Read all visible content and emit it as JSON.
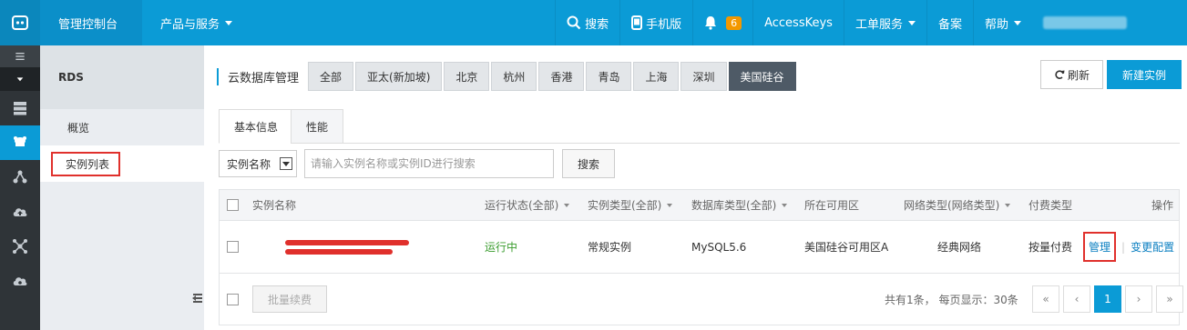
{
  "topbar": {
    "console": "管理控制台",
    "products": "产品与服务",
    "search": "搜索",
    "mobile": "手机版",
    "notify_count": "6",
    "accesskeys": "AccessKeys",
    "tickets": "工单服务",
    "beian": "备案",
    "help": "帮助"
  },
  "sidebar": {
    "title": "RDS",
    "items": [
      {
        "label": "概览"
      },
      {
        "label": "实例列表"
      }
    ]
  },
  "regions": {
    "label": "云数据库管理",
    "items": [
      "全部",
      "亚太(新加坡)",
      "北京",
      "杭州",
      "香港",
      "青岛",
      "上海",
      "深圳",
      "美国硅谷"
    ],
    "selected": "美国硅谷"
  },
  "actions": {
    "refresh": "刷新",
    "new_instance": "新建实例"
  },
  "tabs": [
    "基本信息",
    "性能"
  ],
  "search": {
    "select_value": "实例名称",
    "placeholder": "请输入实例名称或实例ID进行搜索",
    "button": "搜索"
  },
  "table": {
    "headers": {
      "name": "实例名称",
      "status": "运行状态(全部)",
      "type": "实例类型(全部)",
      "db_type": "数据库类型(全部)",
      "zone": "所在可用区",
      "network": "网络类型(网络类型)",
      "billing": "付费类型",
      "ops": "操作"
    },
    "rows": [
      {
        "status": "运行中",
        "type": "常规实例",
        "db_type": "MySQL5.6",
        "zone": "美国硅谷可用区A",
        "network": "经典网络",
        "billing": "按量付费",
        "manage": "管理",
        "change": "变更配置"
      }
    ]
  },
  "footer": {
    "batch_renew": "批量续费",
    "summary": "共有1条， 每页显示：30条",
    "pager": [
      "«",
      "‹",
      "1",
      "›",
      "»"
    ],
    "current_page": "1"
  },
  "colors": {
    "brand_blue": "#0b9bd6",
    "dark_rail": "#2f3438",
    "highlight_red": "#e0302c",
    "running_green": "#3a9c2e"
  }
}
